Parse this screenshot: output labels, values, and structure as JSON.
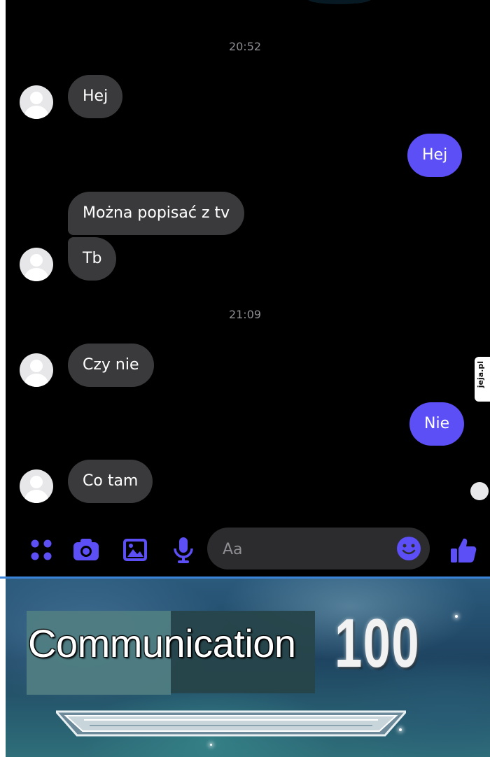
{
  "chat": {
    "timestamps": [
      "20:52",
      "21:09"
    ],
    "messages": [
      {
        "from": "contact",
        "text": "Hej"
      },
      {
        "from": "me",
        "text": "Hej"
      },
      {
        "from": "contact",
        "text": "Można popisać z tv"
      },
      {
        "from": "contact",
        "text": "Tb"
      },
      {
        "from": "contact",
        "text": "Czy nie"
      },
      {
        "from": "me",
        "text": "Nie"
      },
      {
        "from": "contact",
        "text": "Co tam"
      }
    ]
  },
  "composer": {
    "placeholder": "Aa"
  },
  "toolbar": {
    "icons": [
      "apps-grid-icon",
      "camera-icon",
      "gallery-icon",
      "microphone-icon",
      "emoji-icon",
      "thumbs-up-icon"
    ]
  },
  "watermark": {
    "text": "jeja.pl"
  },
  "meme": {
    "skill_name": "Communication",
    "skill_level": "100"
  },
  "colors": {
    "accent": "#5b4ff5",
    "incoming_bubble": "#3a3a3c",
    "background": "#000000"
  }
}
